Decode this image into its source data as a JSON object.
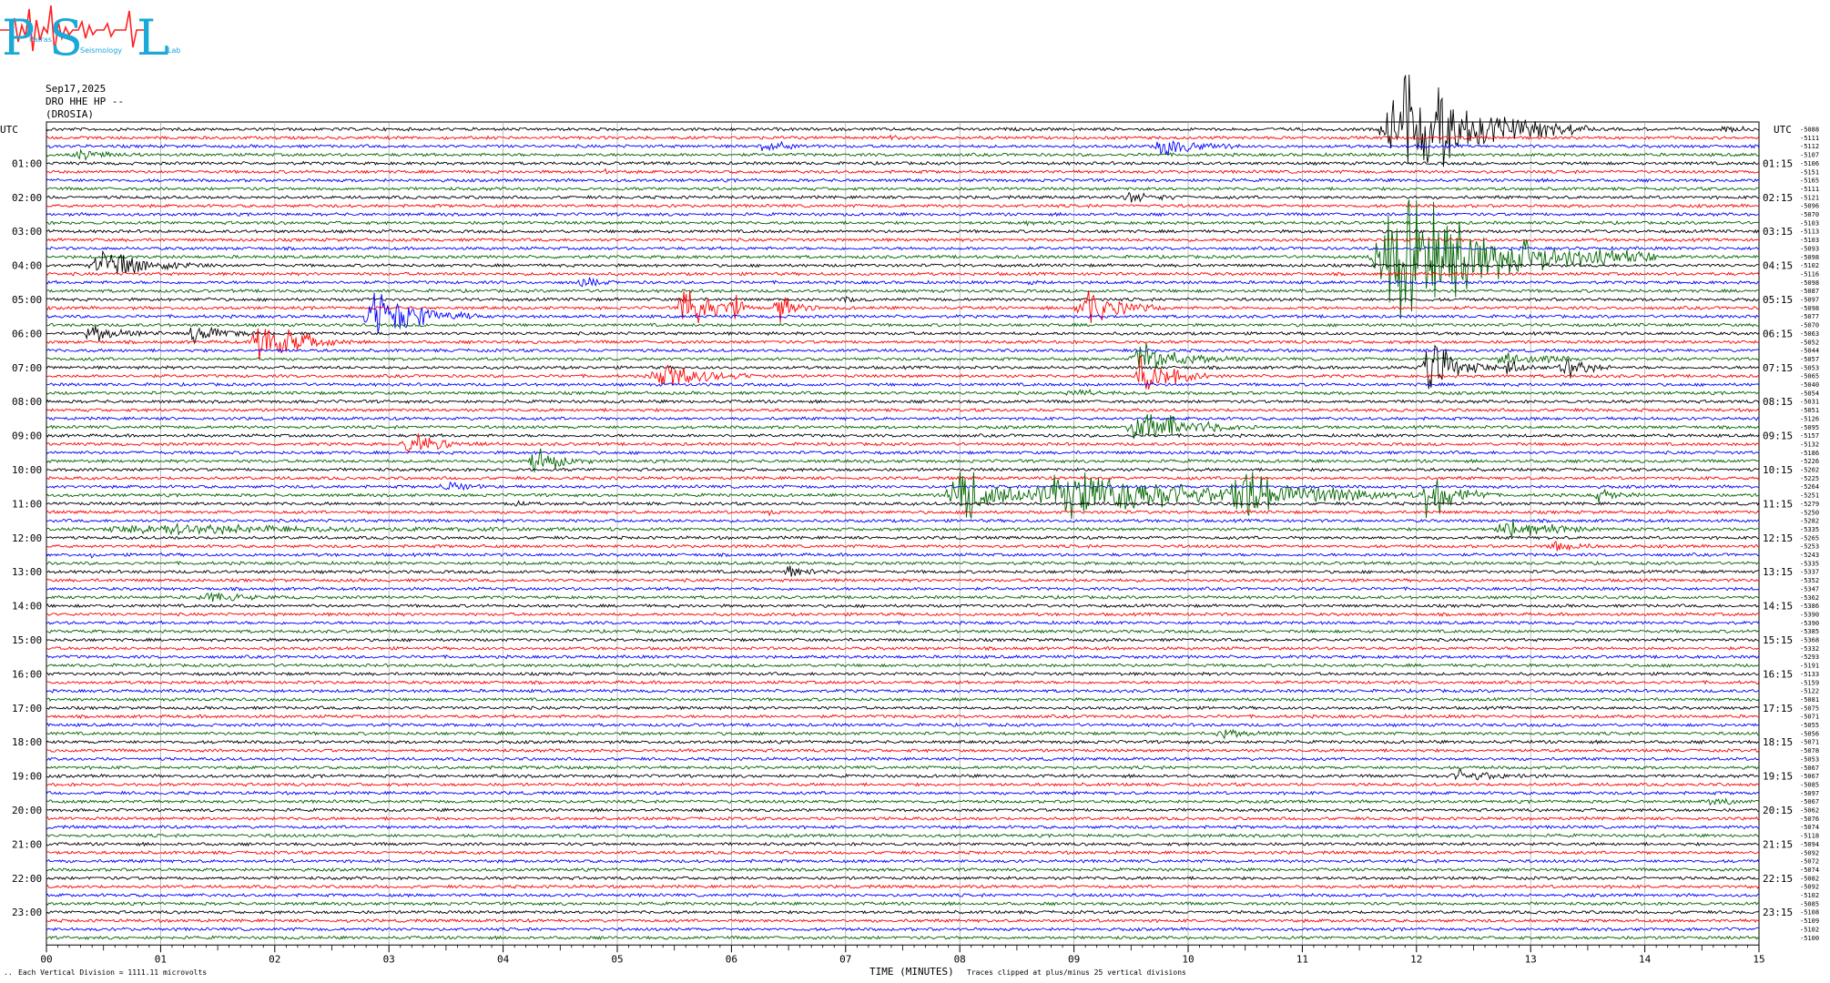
{
  "logo": {
    "letters": "PSL",
    "subtitle_words": [
      "Patras",
      "Seismology",
      "Lab"
    ],
    "color_letters": "#19a8d8",
    "color_wave": "#ff2020"
  },
  "header": {
    "date": "Sep17,2025",
    "channel": "DRO HHE HP --",
    "station": "(DROSIA)"
  },
  "footer": {
    "scale_note": "Each Vertical Division = 1111.11 microvolts",
    "xlabel": "TIME (MINUTES)",
    "clip_note": "Traces clipped at plus/minus 25 vertical divisions",
    "corner_mark": ".."
  },
  "colors": {
    "trace_cycle": [
      "#000000",
      "#ff0000",
      "#0000ff",
      "#006400"
    ],
    "grid": "#a0a0a0"
  },
  "chart_data": {
    "type": "helicorder",
    "title": "DRO HHE HP --",
    "xlabel": "TIME (MINUTES)",
    "xlim": [
      0,
      15
    ],
    "x_ticks": [
      "00",
      "01",
      "02",
      "03",
      "04",
      "05",
      "06",
      "07",
      "08",
      "09",
      "10",
      "11",
      "12",
      "13",
      "14",
      "15"
    ],
    "left_axis_title": "UTC",
    "right_axis_title": "UTC",
    "lines_count": 96,
    "left_hour_labels": [
      "01:00",
      "02:00",
      "03:00",
      "04:00",
      "05:00",
      "06:00",
      "07:00",
      "08:00",
      "09:00",
      "10:00",
      "11:00",
      "12:00",
      "13:00",
      "14:00",
      "15:00",
      "16:00",
      "17:00",
      "18:00",
      "19:00",
      "20:00",
      "21:00",
      "22:00",
      "23:00"
    ],
    "right_hour_labels": [
      "01:15",
      "02:15",
      "03:15",
      "04:15",
      "05:15",
      "06:15",
      "07:15",
      "08:15",
      "09:15",
      "10:15",
      "11:15",
      "12:15",
      "13:15",
      "14:15",
      "15:15",
      "16:15",
      "17:15",
      "18:15",
      "19:15",
      "20:15",
      "21:15",
      "22:15",
      "23:15"
    ],
    "offsets": [
      "-5088",
      "-5111",
      "-5112",
      "-5107",
      "-5106",
      "-5151",
      "-5165",
      "-5111",
      "-5121",
      "-5096",
      "-5070",
      "-5103",
      "-5113",
      "-5103",
      "-5093",
      "-5098",
      "-5102",
      "-5116",
      "-5098",
      "-5087",
      "-5097",
      "-5098",
      "-5077",
      "-5070",
      "-5063",
      "-5052",
      "-5044",
      "-5057",
      "-5053",
      "-5065",
      "-5040",
      "-5054",
      "-5031",
      "-5051",
      "-5126",
      "-5095",
      "-5157",
      "-5132",
      "-5186",
      "-5226",
      "-5202",
      "-5225",
      "-5264",
      "-5251",
      "-5279",
      "-5250",
      "-5282",
      "-5335",
      "-5265",
      "-5253",
      "-5243",
      "-5335",
      "-5337",
      "-5352",
      "-5347",
      "-5362",
      "-5386",
      "-5390",
      "-5390",
      "-5385",
      "-5368",
      "-5332",
      "-5293",
      "-5191",
      "-5133",
      "-5159",
      "-5122",
      "-5081",
      "-5075",
      "-5071",
      "-5055",
      "-5056",
      "-5071",
      "-5078",
      "-5053",
      "-5067",
      "-5067",
      "-5085",
      "-5097",
      "-5067",
      "-5062",
      "-5076",
      "-5074",
      "-5118",
      "-5094",
      "-5092",
      "-5072",
      "-5074",
      "-5082",
      "-5092",
      "-5102",
      "-5085",
      "-5108",
      "-5109",
      "-5102",
      "-5100"
    ],
    "events": [
      {
        "line": 0,
        "t": 11.9,
        "amp": 6.0,
        "dur": 1.6
      },
      {
        "line": 0,
        "t": 14.7,
        "amp": 0.6,
        "dur": 0.3
      },
      {
        "line": 1,
        "t": 7.4,
        "amp": 0.3,
        "dur": 0.2
      },
      {
        "line": 2,
        "t": 6.3,
        "amp": 0.5,
        "dur": 0.6
      },
      {
        "line": 2,
        "t": 9.8,
        "amp": 1.0,
        "dur": 0.7
      },
      {
        "line": 3,
        "t": 0.3,
        "amp": 0.4,
        "dur": 0.6
      },
      {
        "line": 5,
        "t": 4.9,
        "amp": 0.5,
        "dur": 0.1
      },
      {
        "line": 8,
        "t": 9.5,
        "amp": 0.6,
        "dur": 0.5
      },
      {
        "line": 11,
        "t": 8.5,
        "amp": 0.3,
        "dur": 0.4
      },
      {
        "line": 15,
        "t": 11.9,
        "amp": 7.0,
        "dur": 2.2
      },
      {
        "line": 16,
        "t": 0.5,
        "amp": 1.6,
        "dur": 1.0
      },
      {
        "line": 18,
        "t": 4.7,
        "amp": 0.6,
        "dur": 0.3
      },
      {
        "line": 18,
        "t": 8.6,
        "amp": 0.6,
        "dur": 0.2
      },
      {
        "line": 20,
        "t": 1.4,
        "amp": 0.2,
        "dur": 0.1
      },
      {
        "line": 20,
        "t": 7.0,
        "amp": 0.3,
        "dur": 0.2
      },
      {
        "line": 21,
        "t": 5.6,
        "amp": 3.0,
        "dur": 0.5
      },
      {
        "line": 21,
        "t": 6.0,
        "amp": 2.2,
        "dur": 0.2
      },
      {
        "line": 21,
        "t": 6.4,
        "amp": 1.8,
        "dur": 0.4
      },
      {
        "line": 21,
        "t": 9.1,
        "amp": 2.2,
        "dur": 0.7
      },
      {
        "line": 22,
        "t": 2.9,
        "amp": 3.0,
        "dur": 0.9
      },
      {
        "line": 24,
        "t": 0.4,
        "amp": 0.9,
        "dur": 0.6
      },
      {
        "line": 24,
        "t": 1.3,
        "amp": 1.4,
        "dur": 0.5
      },
      {
        "line": 25,
        "t": 1.9,
        "amp": 2.6,
        "dur": 0.8
      },
      {
        "line": 27,
        "t": 9.6,
        "amp": 1.6,
        "dur": 0.9
      },
      {
        "line": 27,
        "t": 12.8,
        "amp": 0.6,
        "dur": 1.0
      },
      {
        "line": 28,
        "t": 12.1,
        "amp": 3.2,
        "dur": 0.6
      },
      {
        "line": 28,
        "t": 13.3,
        "amp": 1.6,
        "dur": 0.4
      },
      {
        "line": 28,
        "t": 12.8,
        "amp": 1.0,
        "dur": 0.3
      },
      {
        "line": 29,
        "t": 5.4,
        "amp": 1.5,
        "dur": 0.9
      },
      {
        "line": 29,
        "t": 9.6,
        "amp": 2.2,
        "dur": 0.7
      },
      {
        "line": 31,
        "t": 9.0,
        "amp": 0.4,
        "dur": 0.6
      },
      {
        "line": 35,
        "t": 9.6,
        "amp": 2.2,
        "dur": 1.0
      },
      {
        "line": 37,
        "t": 3.2,
        "amp": 1.0,
        "dur": 0.8
      },
      {
        "line": 39,
        "t": 4.3,
        "amp": 1.6,
        "dur": 0.5
      },
      {
        "line": 42,
        "t": 3.5,
        "amp": 0.5,
        "dur": 0.5
      },
      {
        "line": 43,
        "t": 9.0,
        "amp": 3.0,
        "dur": 2.5
      },
      {
        "line": 43,
        "t": 8.0,
        "amp": 3.0,
        "dur": 1.0
      },
      {
        "line": 43,
        "t": 10.5,
        "amp": 2.4,
        "dur": 1.5
      },
      {
        "line": 43,
        "t": 12.1,
        "amp": 2.8,
        "dur": 0.6
      },
      {
        "line": 43,
        "t": 13.6,
        "amp": 0.6,
        "dur": 0.4
      },
      {
        "line": 44,
        "t": 4.1,
        "amp": 0.4,
        "dur": 0.2
      },
      {
        "line": 45,
        "t": 6.3,
        "amp": 0.5,
        "dur": 0.1
      },
      {
        "line": 47,
        "t": 1.0,
        "amp": 0.5,
        "dur": 4.0
      },
      {
        "line": 47,
        "t": 12.8,
        "amp": 1.2,
        "dur": 0.9
      },
      {
        "line": 49,
        "t": 13.2,
        "amp": 0.5,
        "dur": 0.6
      },
      {
        "line": 50,
        "t": 0.4,
        "amp": 0.2,
        "dur": 0.1
      },
      {
        "line": 52,
        "t": 6.5,
        "amp": 0.6,
        "dur": 0.5
      },
      {
        "line": 55,
        "t": 1.4,
        "amp": 0.5,
        "dur": 0.8
      },
      {
        "line": 71,
        "t": 10.3,
        "amp": 0.5,
        "dur": 0.5
      },
      {
        "line": 75,
        "t": 4.4,
        "amp": 0.2,
        "dur": 0.2
      },
      {
        "line": 76,
        "t": 12.4,
        "amp": 0.6,
        "dur": 0.8
      },
      {
        "line": 79,
        "t": 14.6,
        "amp": 0.4,
        "dur": 0.4
      }
    ]
  }
}
